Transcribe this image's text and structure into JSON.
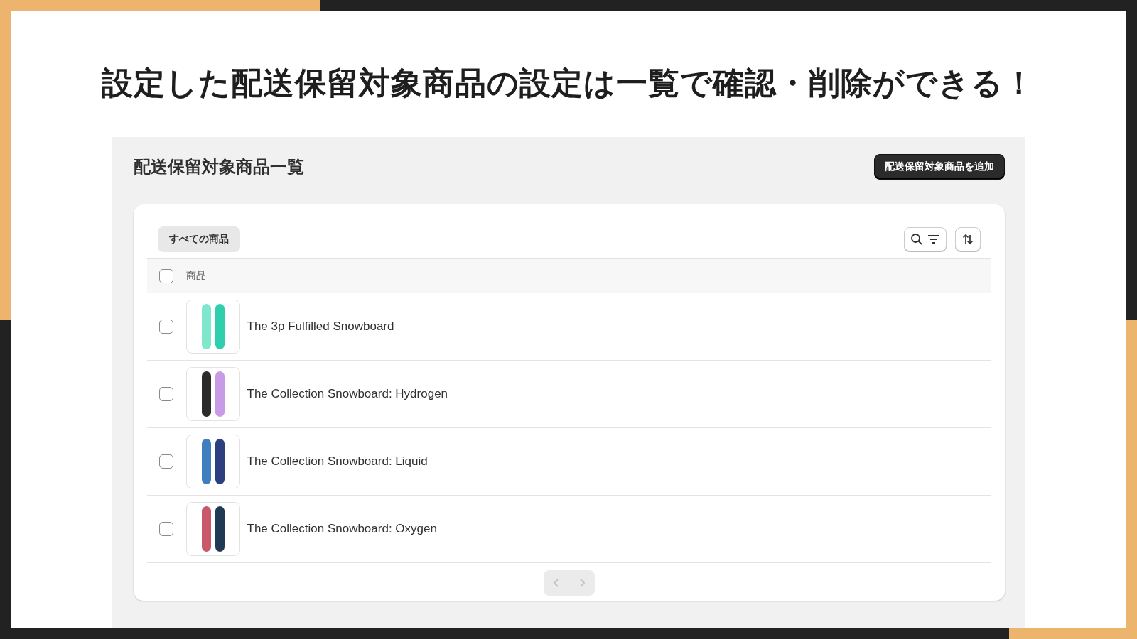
{
  "headline": "設定した配送保留対象商品の設定は一覧で確認・削除ができる！",
  "page": {
    "title": "配送保留対象商品一覧",
    "add_button": "配送保留対象商品を追加"
  },
  "filter_tabs": [
    {
      "label": "すべての商品",
      "selected": true
    }
  ],
  "table": {
    "header": {
      "label": "商品",
      "checked": false
    },
    "rows": [
      {
        "name": "The 3p Fulfilled Snowboard",
        "checked": false
      },
      {
        "name": "The Collection Snowboard: Hydrogen",
        "checked": false
      },
      {
        "name": "The Collection Snowboard: Liquid",
        "checked": false
      },
      {
        "name": "The Collection Snowboard: Oxygen",
        "checked": false
      }
    ]
  },
  "pagination": {
    "previous_disabled": true,
    "next_disabled": true
  }
}
